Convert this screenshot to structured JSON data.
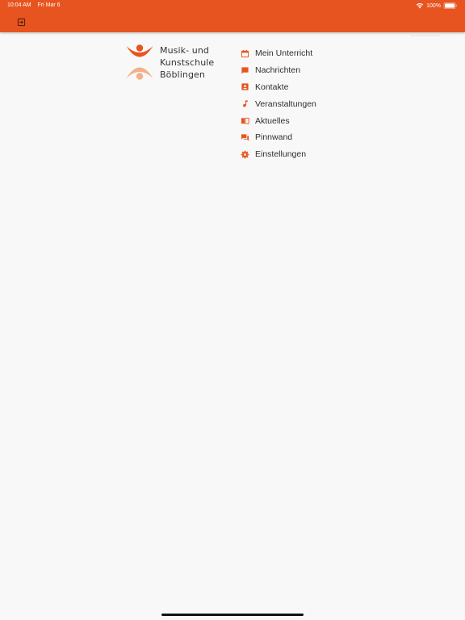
{
  "status_bar": {
    "time": "10:04 AM",
    "date": "Fri Mar 6",
    "battery_percent": "100%",
    "battery_level": 1.0
  },
  "colors": {
    "accent": "#e8541f",
    "logo_light": "#f4b08a",
    "background": "#f8f8f8",
    "text": "#2f2f2f"
  },
  "logo": {
    "line1": "Musik- und",
    "line2": "Kunstschule",
    "line3": "Böblingen"
  },
  "menu": {
    "items": [
      {
        "label": "Mein Unterricht",
        "icon": "calendar-icon"
      },
      {
        "label": "Nachrichten",
        "icon": "chat-bubble-icon"
      },
      {
        "label": "Kontakte",
        "icon": "contact-card-icon"
      },
      {
        "label": "Veranstaltungen",
        "icon": "music-note-icon"
      },
      {
        "label": "Aktuelles",
        "icon": "open-book-icon"
      },
      {
        "label": "Pinnwand",
        "icon": "forum-icon"
      },
      {
        "label": "Einstellungen",
        "icon": "gear-icon"
      }
    ]
  }
}
